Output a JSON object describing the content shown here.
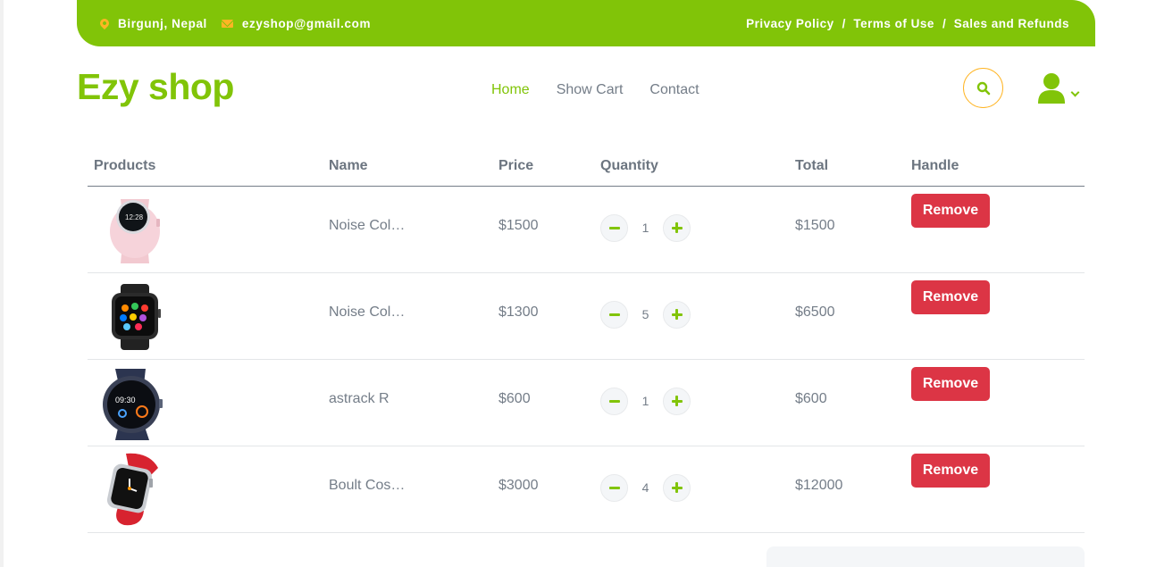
{
  "topbar": {
    "location": "Birgunj, Nepal",
    "email": "ezyshop@gmail.com",
    "links": [
      "Privacy Policy",
      "Terms of Use",
      "Sales and Refunds"
    ],
    "separator": "/",
    "accent_color": "#81c408",
    "icon_color": "#ffb524"
  },
  "brand": {
    "logo": "Ezy shop"
  },
  "nav": {
    "home": "Home",
    "cart": "Show Cart",
    "contact": "Contact"
  },
  "icons": {
    "search": "search-icon",
    "user": "user-icon",
    "dropdown": "chevron-down-icon"
  },
  "table": {
    "headers": {
      "products": "Products",
      "name": "Name",
      "price": "Price",
      "quantity": "Quantity",
      "total": "Total",
      "handle": "Handle"
    },
    "rows": [
      {
        "name": "Noise ColorFit",
        "price": "$1500",
        "qty": "1",
        "total": "$1500",
        "remove": "Remove",
        "image": "pink smartwatch"
      },
      {
        "name": "Noise ColorFit",
        "price": "$1300",
        "qty": "5",
        "total": "$6500",
        "remove": "Remove",
        "image": "black smartwatch"
      },
      {
        "name": "astrack R",
        "price": "$600",
        "qty": "1",
        "total": "$600",
        "remove": "Remove",
        "image": "navy round smartwatch"
      },
      {
        "name": "Boult Cosmic",
        "price": "$3000",
        "qty": "4",
        "total": "$12000",
        "remove": "Remove",
        "image": "red smartwatch"
      }
    ]
  },
  "colors": {
    "remove_button": "#dc3545",
    "text_muted": "#747d88"
  }
}
